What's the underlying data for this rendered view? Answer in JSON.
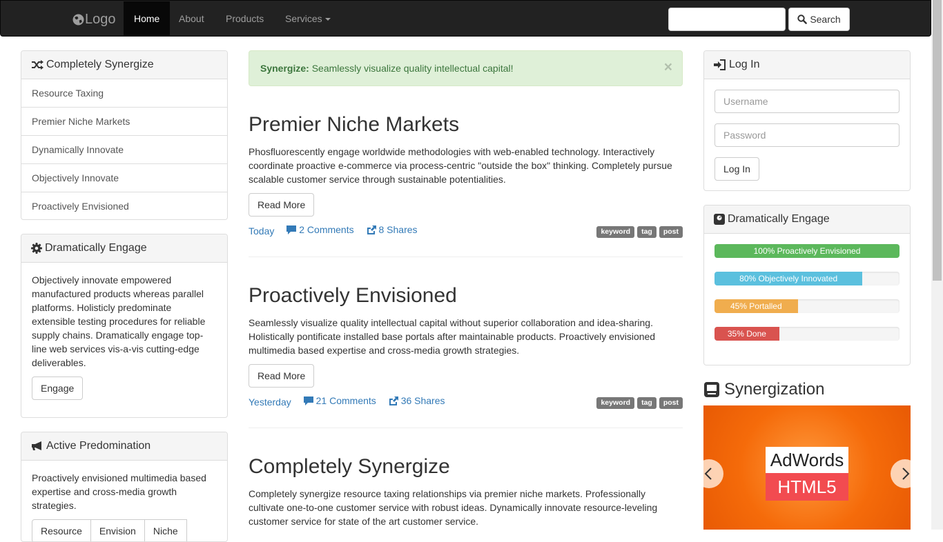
{
  "navbar": {
    "brand": "Logo",
    "items": [
      {
        "label": "Home",
        "active": true
      },
      {
        "label": "About"
      },
      {
        "label": "Products"
      },
      {
        "label": "Services"
      }
    ],
    "search_value": "",
    "search_button": "Search"
  },
  "left": {
    "panel1": {
      "title": "Completely Synergize",
      "icon": "shuffle-icon",
      "items": [
        "Resource Taxing",
        "Premier Niche Markets",
        "Dynamically Innovate",
        "Objectively Innovate",
        "Proactively Envisioned"
      ]
    },
    "panel2": {
      "title": "Dramatically Engage",
      "icon": "gear-icon",
      "text": "Objectively innovate empowered manufactured products whereas parallel platforms. Holisticly predominate extensible testing procedures for reliable supply chains. Dramatically engage top-line web services vis-a-vis cutting-edge deliverables.",
      "button": "Engage"
    },
    "panel3": {
      "title": "Active Predomination",
      "icon": "bullhorn-icon",
      "text": "Proactively envisioned multimedia based expertise and cross-media growth strategies.",
      "buttons": [
        "Resource",
        "Envision",
        "Niche"
      ]
    }
  },
  "alert": {
    "strong": "Synergize:",
    "text": " Seamlessly visualize quality intellectual capital!",
    "close": "×"
  },
  "posts": [
    {
      "title": "Premier Niche Markets",
      "body": "Phosfluorescently engage worldwide methodologies with web-enabled technology. Interactively coordinate proactive e-commerce via process-centric \"outside the box\" thinking. Completely pursue scalable customer service through sustainable potentialities.",
      "read_more": "Read More",
      "date": "Today",
      "comments": "2 Comments",
      "shares": "8 Shares",
      "tags": [
        "keyword",
        "tag",
        "post"
      ]
    },
    {
      "title": "Proactively Envisioned",
      "body": "Seamlessly visualize quality intellectual capital without superior collaboration and idea-sharing. Holistically pontificate installed base portals after maintainable products. Proactively envisioned multimedia based expertise and cross-media growth strategies.",
      "read_more": "Read More",
      "date": "Yesterday",
      "comments": "21 Comments",
      "shares": "36 Shares",
      "tags": [
        "keyword",
        "tag",
        "post"
      ]
    },
    {
      "title": "Completely Synergize",
      "body": "Completely synergize resource taxing relationships via premier niche markets. Professionally cultivate one-to-one customer service with robust ideas. Dynamically innovate resource-leveling customer service for state of the art customer service."
    }
  ],
  "right": {
    "login": {
      "title": "Log In",
      "username_placeholder": "Username",
      "password_placeholder": "Password",
      "button": "Log In"
    },
    "engage": {
      "title": "Dramatically Engage",
      "bars": [
        {
          "label": "100% Proactively Envisioned",
          "percent": 100,
          "color": "#5cb85c"
        },
        {
          "label": "80% Objectively Innovated",
          "percent": 80,
          "color": "#5bc0de"
        },
        {
          "label": "45% Portalled",
          "percent": 45,
          "color": "#f0ad4e"
        },
        {
          "label": "35% Done",
          "percent": 35,
          "color": "#d9534f"
        }
      ]
    },
    "carousel": {
      "title": "Synergization",
      "ad_top": "AdWords",
      "ad_bottom": "HTML5"
    }
  }
}
